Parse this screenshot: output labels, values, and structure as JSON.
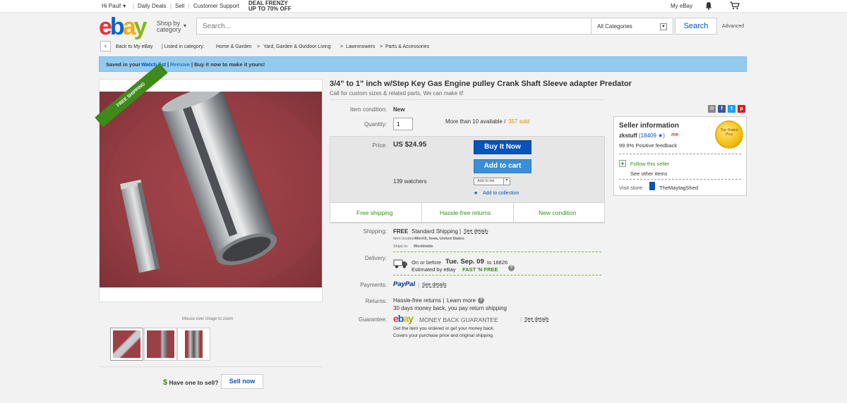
{
  "topbar": {
    "greeting": "Hi Paul! ▾",
    "daily_deals": "Daily Deals",
    "sell": "Sell",
    "customer_support": "Customer Support",
    "deal_line1": "DEAL FRENZY",
    "deal_line2": "UP TO 70% OFF",
    "my_ebay": "My eBay"
  },
  "header": {
    "shop_by_line1": "Shop by",
    "shop_by_line2": "category",
    "search_placeholder": "Search...",
    "category_select": "All Categories",
    "search_button": "Search",
    "advanced": "Advanced"
  },
  "breadcrumb": {
    "back": "Back to My eBay",
    "listed_in": "| Listed in category:",
    "items": [
      "Home & Garden",
      ">",
      "Yard, Garden & Outdoor Living",
      ">",
      "Lawnmowers",
      ">",
      "Parts & Accessories"
    ]
  },
  "banner": {
    "saved": "Saved in your",
    "watch_list": "Watch list",
    "sep1": "|",
    "remove": "Remove",
    "rest": "| Buy it now to make it yours!"
  },
  "image": {
    "ribbon": "FREE SHIPPING",
    "zoom_hint": "Mouse over image to zoom"
  },
  "sell_prompt": {
    "question": "Have one to sell?",
    "button": "Sell now"
  },
  "item": {
    "title": "3/4\" to 1\" inch w/Step Key Gas Engine pulley Crank Shaft Sleeve adapter Predator",
    "subtitle": "Call for custom sizes & related parts, We can make it!",
    "condition_label": "Item condition:",
    "condition_value": "New",
    "quantity_label": "Quantity:",
    "quantity_value": "1",
    "availability": "More than 10 available /",
    "sold": "357 sold",
    "price_label": "Price:",
    "price_value": "US $24.95",
    "watchers": "139 watchers",
    "buy_now": "Buy It Now",
    "add_to_cart": "Add to cart",
    "add_to_list": "Add to list",
    "add_to_collection": "Add to collection",
    "perks": [
      "Free shipping",
      "Hassle-free returns",
      "New condition"
    ]
  },
  "details": {
    "shipping_label": "Shipping:",
    "shipping_free": "FREE",
    "shipping_method": "Standard Shipping |",
    "see_details": "See details",
    "item_location_label": "Item location:",
    "item_location": "Merrill, Iowa, United States",
    "ships_to_label": "Ships to:",
    "ships_to": "Worldwide",
    "delivery_label": "Delivery:",
    "delivery_line1_pre": "On or before",
    "delivery_date": "Tue. Sep. 09",
    "delivery_line1_post": "to 18826",
    "delivery_line2_pre": "Estimated by eBay",
    "fast_n_free": "FAST 'N FREE",
    "payments_label": "Payments:",
    "paypal": "PayPal",
    "returns_label": "Returns:",
    "returns_value": "Hassle-free returns |",
    "learn_more": "Learn more",
    "returns_line2": "30 days money back, you pay return shipping",
    "guarantee_label": "Guarantee:",
    "money_back": "MONEY BACK GUARANTEE",
    "guarantee_line1": "Get the item you ordered or get your money back.",
    "guarantee_line2": "Covers your purchase price and original shipping."
  },
  "seller": {
    "heading": "Seller information",
    "name": "zkstuff",
    "feedback_count": "(18409 ★)",
    "me_badge": "me",
    "positive": "99.9% Positive feedback",
    "follow": "Follow this seller",
    "see_other": "See other items",
    "visit_store_label": "Visit store:",
    "store_name": "TheMaytagShed",
    "top_rated": "Top Rated Plus"
  },
  "colors": {
    "ebay_blue": "#0654ba",
    "banner": "#93cbf0",
    "green": "#3e8a1b",
    "sold_orange": "#dd8a00"
  }
}
